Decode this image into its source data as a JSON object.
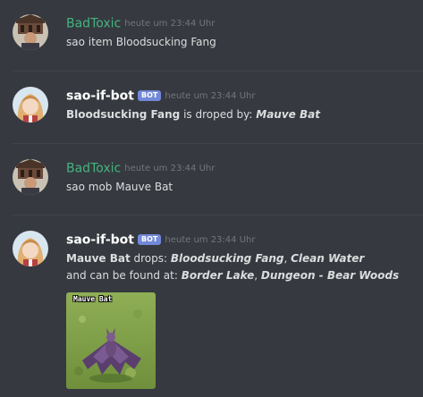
{
  "colors": {
    "background": "#36393f",
    "user_name": "#43b581",
    "bot_name": "#ffffff",
    "bot_tag": "#7289da",
    "timestamp": "#72767d",
    "text": "#dcddde"
  },
  "messages": [
    {
      "author": "BadToxic",
      "timestamp": "heute um 23:44 Uhr",
      "text": "sao item Bloodsucking Fang"
    },
    {
      "author": "sao-if-bot",
      "bot_tag": "BOT",
      "timestamp": "heute um 23:44 Uhr",
      "item": "Bloodsucking Fang",
      "middle": " is droped by: ",
      "mob": "Mauve Bat"
    },
    {
      "author": "BadToxic",
      "timestamp": "heute um 23:44 Uhr",
      "text": "sao mob Mauve Bat"
    },
    {
      "author": "sao-if-bot",
      "bot_tag": "BOT",
      "timestamp": "heute um 23:44 Uhr",
      "mob": "Mauve Bat",
      "drops_label": " drops: ",
      "drop1": "Bloodsucking Fang",
      "sep1": ", ",
      "drop2": "Clean Water",
      "found_label": "and can be found at: ",
      "loc1": "Border Lake",
      "sep2": ", ",
      "loc2": "Dungeon - Bear Woods",
      "image_caption": "Mauve Bat"
    }
  ]
}
